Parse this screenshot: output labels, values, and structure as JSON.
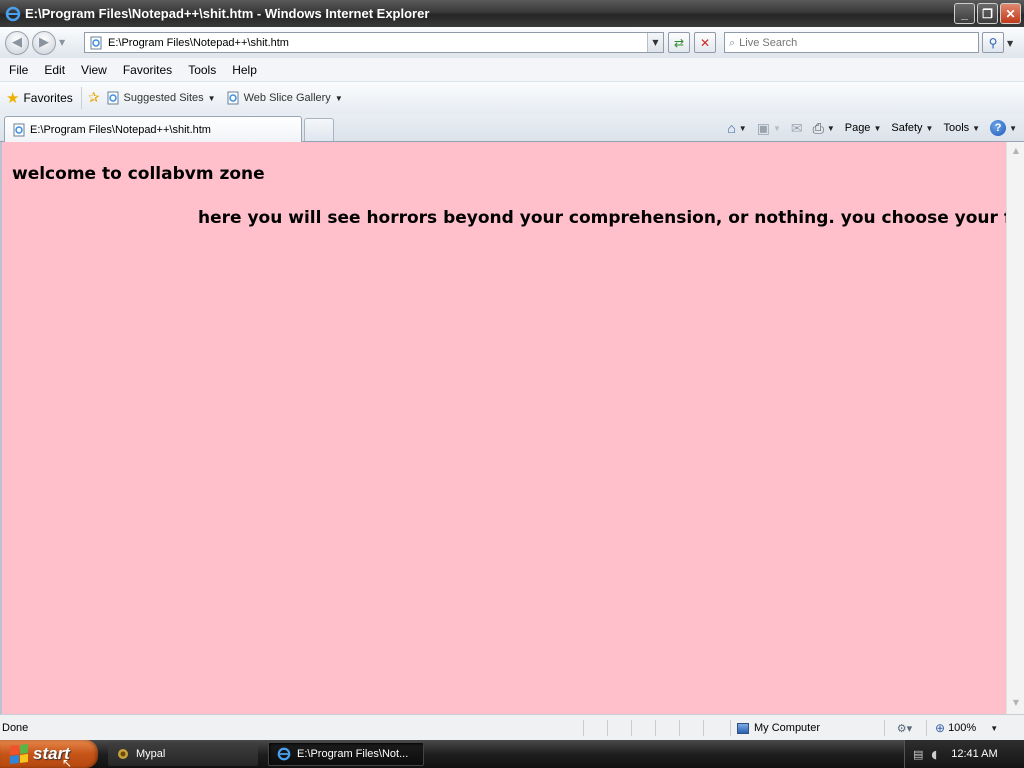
{
  "window": {
    "title": "E:\\Program Files\\Notepad++\\shit.htm - Windows Internet Explorer",
    "controls": {
      "minimize": "_",
      "restore": "❐",
      "close": "✕"
    }
  },
  "address_bar": {
    "url": "E:\\Program Files\\Notepad++\\shit.htm",
    "search_placeholder": "Live Search"
  },
  "menu": [
    "File",
    "Edit",
    "View",
    "Favorites",
    "Tools",
    "Help"
  ],
  "favorites_bar": {
    "favorites_label": "Favorites",
    "links": [
      "Suggested Sites",
      "Web Slice Gallery"
    ]
  },
  "tab": {
    "label": "E:\\Program Files\\Notepad++\\shit.htm"
  },
  "command_bar": {
    "page": "Page",
    "safety": "Safety",
    "tools": "Tools"
  },
  "page": {
    "background_color": "#ffc0cb",
    "heading1": "welcome to collabvm zone",
    "heading2": "here you will see horrors beyond your comprehension, or nothing. you choose your fate"
  },
  "status_bar": {
    "status": "Done",
    "zone": "My Computer",
    "zoom": "100%"
  },
  "taskbar": {
    "start_label": "start",
    "buttons": [
      "Mypal",
      "E:\\Program Files\\Not..."
    ],
    "clock": "12:41 AM"
  }
}
